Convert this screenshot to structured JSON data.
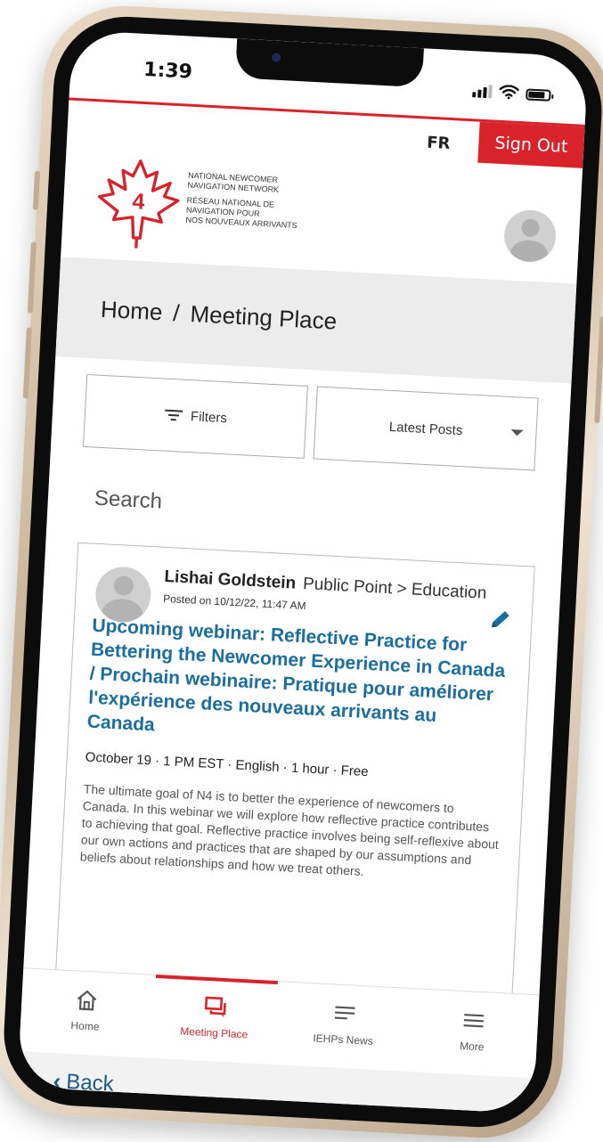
{
  "status_bar": {
    "time": "1:39",
    "signal_bars": 3,
    "battery_level": 0.8
  },
  "top_bar": {
    "language_toggle": "FR",
    "sign_out": "Sign Out"
  },
  "brand": {
    "logo_text_en_1": "NATIONAL NEWCOMER",
    "logo_text_en_2": "NAVIGATION NETWORK",
    "logo_text_fr_1": "RÉSEAU NATIONAL DE",
    "logo_text_fr_2": "NAVIGATION POUR",
    "logo_text_fr_3": "NOS NOUVEAUX ARRIVANTS",
    "logo_mark": "4",
    "accent_color": "#d8232a"
  },
  "breadcrumb": {
    "home": "Home",
    "separator": "/",
    "current": "Meeting Place"
  },
  "controls": {
    "filters_label": "Filters",
    "sort_selected": "Latest Posts"
  },
  "search": {
    "label": "Search"
  },
  "post": {
    "author": "Lishai Goldstein",
    "category": "Public Point > Education",
    "posted": "Posted on 10/12/22, 11:47 AM",
    "title": "Upcoming webinar: Reflective Practice for Bettering the Newcomer Experience in Canada / Prochain webinaire: Pratique pour améliorer l'expérience des nouveaux arrivants au Canada",
    "details": "October 19 · 1 PM EST · English · 1 hour · Free",
    "body": "The ultimate goal of N4 is to better the experience of newcomers to Canada. In this webinar we will explore how reflective practice contributes to achieving that goal. Reflective practice involves being self-reflexive about our own actions and practices that are shaped by our assumptions and beliefs about relationships and how we treat others.",
    "title_color": "#1a6fa0"
  },
  "tabs": [
    {
      "label": "Home",
      "icon": "home-icon",
      "active": false
    },
    {
      "label": "Meeting Place",
      "icon": "chat-icon",
      "active": true
    },
    {
      "label": "IEHPs News",
      "icon": "news-icon",
      "active": false
    },
    {
      "label": "More",
      "icon": "menu-icon",
      "active": false
    }
  ],
  "navigation": {
    "back_label": "Back"
  }
}
